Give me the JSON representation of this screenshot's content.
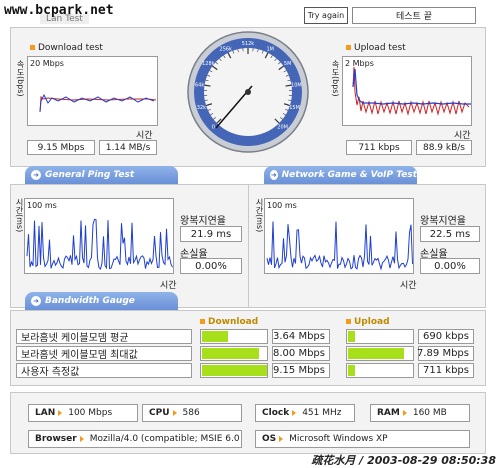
{
  "watermark_top": "www.bcpark.net",
  "header": {
    "title_partial": "Lan Test",
    "try_again": "Try again",
    "end_label": "테스트 끝"
  },
  "download_test": {
    "title": "Download test",
    "ylabel": "속도(bps)",
    "scale": "20 Mbps",
    "xlabel": "시간",
    "value1": "9.15 Mbps",
    "value2": "1.14 MB/s"
  },
  "upload_test": {
    "title": "Upload test",
    "ylabel": "속도(bps)",
    "scale": "2 Mbps",
    "xlabel": "시간",
    "value1": "711 kbps",
    "value2": "88.9 kB/s"
  },
  "gauge": {
    "ticks": [
      "20M",
      "15M",
      "10M",
      "5M",
      "1M",
      "512k",
      "256k",
      "128k",
      "64k",
      "32k",
      "0"
    ],
    "needle_value": "9.15 Mbps"
  },
  "tabs": {
    "ping": "General Ping Test",
    "game": "Network Game & VoIP Test",
    "bandwidth": "Bandwidth Gauge"
  },
  "ping_general": {
    "ylabel": "시간(ms)",
    "scale": "100 ms",
    "xlabel": "시간",
    "rtt_label": "왕복지연율",
    "rtt_value": "21.9 ms",
    "loss_label": "손실율",
    "loss_value": "0.00%"
  },
  "ping_game": {
    "ylabel": "시간(ms)",
    "scale": "100 ms",
    "xlabel": "시간",
    "rtt_label": "왕복지연율",
    "rtt_value": "22.5 ms",
    "loss_label": "손실율",
    "loss_value": "0.00%"
  },
  "bandwidth": {
    "download_header": "Download",
    "upload_header": "Upload",
    "rows": [
      {
        "label": "보라홈넷 케이블모뎀 평균",
        "down": "3.64 Mbps",
        "down_fill": 0.4,
        "up": "690 kbps",
        "up_fill": 0.1
      },
      {
        "label": "보라홈넷 케이블모뎀 최대값",
        "down": "8.00 Mbps",
        "down_fill": 0.86,
        "up": "7.89 Mbps",
        "up_fill": 0.85
      },
      {
        "label": "사용자 측정값",
        "down": "9.15 Mbps",
        "down_fill": 0.98,
        "up": "711 kbps",
        "up_fill": 0.1
      }
    ]
  },
  "system": {
    "lan_label": "LAN",
    "lan_value": "100 Mbps",
    "cpu_label": "CPU",
    "cpu_value": "586",
    "clock_label": "Clock",
    "clock_value": "451 MHz",
    "ram_label": "RAM",
    "ram_value": "160 MB",
    "browser_label": "Browser",
    "browser_value": "Mozilla/4.0 (compatible; MSIE 6.0",
    "os_label": "OS",
    "os_value": "Microsoft Windows XP"
  },
  "watermark_bottom": "疏花水月 / 2003-08-29 08:50:38",
  "colors": {
    "accent": "#f59a1a",
    "bar_fill": "#a7e01a",
    "series_blue": "#1f3fd0",
    "series_red": "#d02020",
    "tab_blue": "#6a90d8"
  }
}
